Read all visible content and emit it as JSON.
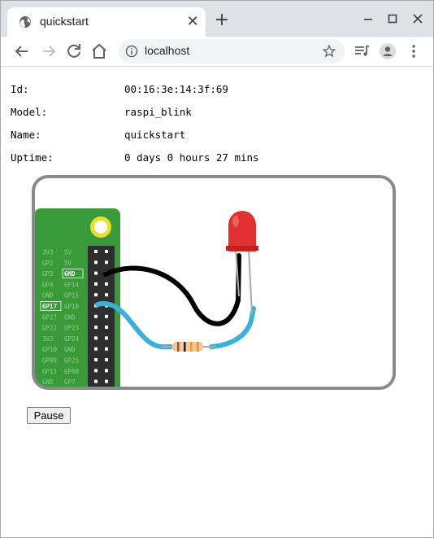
{
  "browser": {
    "tab_title": "quickstart",
    "url": "localhost"
  },
  "device": {
    "id_label": "Id:",
    "id_value": "00:16:3e:14:3f:69",
    "model_label": "Model:",
    "model_value": "raspi_blink",
    "name_label": "Name:",
    "name_value": "quickstart",
    "uptime_label": "Uptime:",
    "uptime_value": "0 days 0 hours 27 mins"
  },
  "pins": {
    "left": [
      "3V3",
      "GP2",
      "GP3",
      "GP4",
      "GND",
      "GP17",
      "GP27",
      "GP22",
      "3V3",
      "GP10",
      "GP09",
      "GP11",
      "GND"
    ],
    "right": [
      "5V",
      "5V",
      "GND",
      "GP14",
      "GP15",
      "GP18",
      "GND",
      "GP23",
      "GP24",
      "GND",
      "GP25",
      "GP08",
      "GP7"
    ]
  },
  "pause_label": "Pause",
  "colors": {
    "board_green": "#3a9a3a",
    "wire_blue": "#3bb0d8",
    "wire_black": "#000000",
    "led_red": "#e03030"
  }
}
